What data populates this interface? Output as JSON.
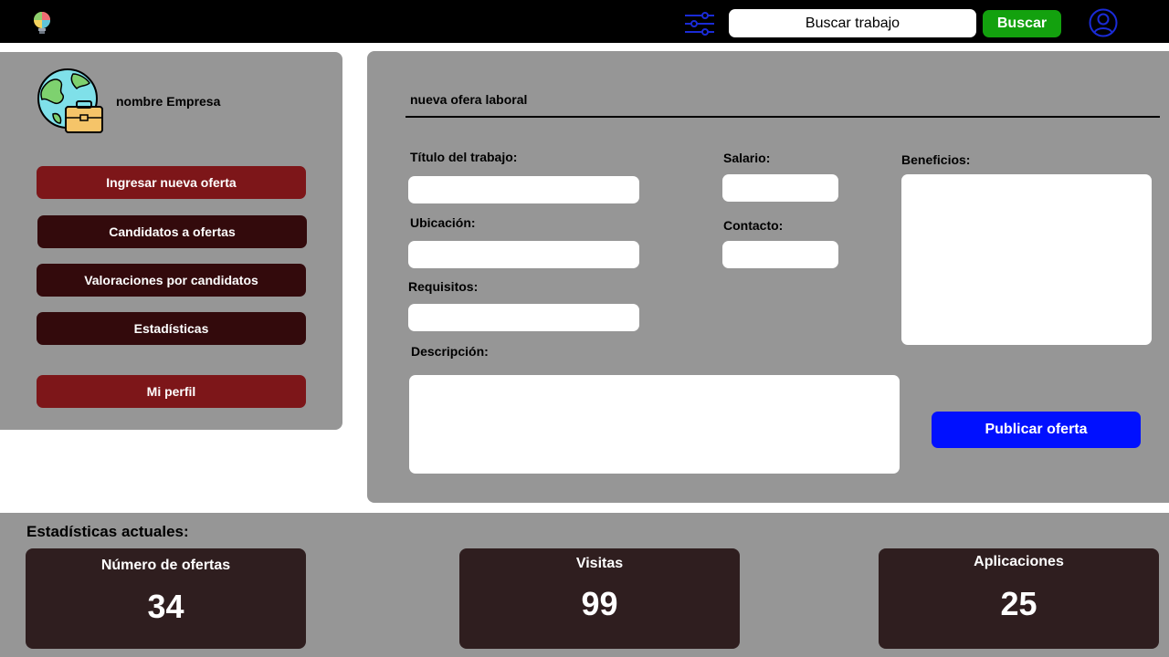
{
  "header": {
    "search_placeholder": "Buscar trabajo",
    "search_button": "Buscar",
    "icons": [
      "lightbulb-logo-icon",
      "filter-sliders-icon",
      "user-account-icon"
    ]
  },
  "sidebar": {
    "company_name": "nombre Empresa",
    "company_icon": "globe-briefcase-icon",
    "items": [
      {
        "label": "Ingresar nueva oferta"
      },
      {
        "label": "Candidatos a ofertas"
      },
      {
        "label": "Valoraciones por candidatos"
      },
      {
        "label": "Estadísticas"
      },
      {
        "label": "Mi perfil"
      }
    ]
  },
  "form": {
    "title": "nueva ofera laboral",
    "fields": {
      "title_label": "Título del trabajo:",
      "location_label": "Ubicación:",
      "requirements_label": "Requisitos:",
      "description_label": "Descripción:",
      "salary_label": "Salario:",
      "contact_label": "Contacto:",
      "benefits_label": "Beneficios:"
    },
    "publish_button": "Publicar oferta"
  },
  "stats": {
    "title": "Estadísticas actuales:",
    "cards": [
      {
        "label": "Número de ofertas",
        "value": "34"
      },
      {
        "label": "Visitas",
        "value": "99"
      },
      {
        "label": "Aplicaciones",
        "value": "25"
      }
    ]
  },
  "colors": {
    "topbar": "#000000",
    "panel": "#969696",
    "accent_active": "#7d1619",
    "accent_dark": "#330a0c",
    "search_button": "#13a10e",
    "publish_button": "#0010ff",
    "stat_card": "#2f1e1f"
  }
}
